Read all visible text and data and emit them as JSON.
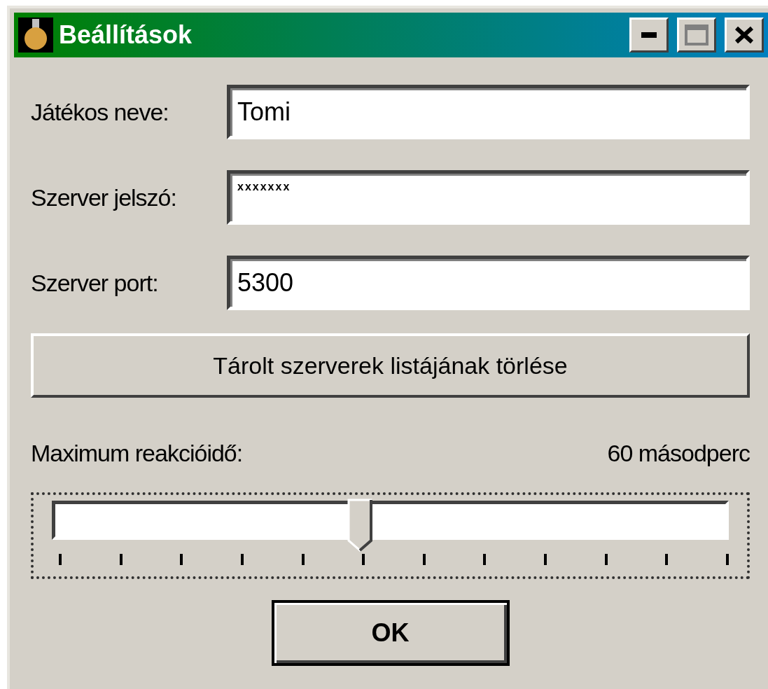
{
  "window": {
    "title": "Beállítások"
  },
  "fields": [
    {
      "label": "Játékos neve:",
      "value": "Tomi",
      "kind": "text"
    },
    {
      "label": "Szerver jelszó:",
      "value": "xxxxxxx",
      "kind": "password"
    },
    {
      "label": "Szerver port:",
      "value": "5300",
      "kind": "text"
    }
  ],
  "clear_button": "Tárolt szerverek listájának törlése",
  "slider": {
    "label": "Maximum reakcióidő:",
    "reading": "60 másodperc",
    "level": 0.4545
  },
  "ok_button": "OK"
}
